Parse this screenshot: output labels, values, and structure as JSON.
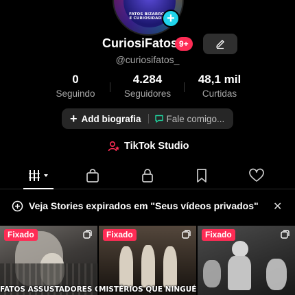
{
  "profile": {
    "avatar_text_line1": "FATOS BIZARROS",
    "avatar_text_line2": "E CURIOSIDADES",
    "display_name": "CuriosiFatos",
    "notification_badge": "9+",
    "handle": "@curiosifatos_"
  },
  "stats": [
    {
      "value": "0",
      "label": "Seguindo"
    },
    {
      "value": "4.284",
      "label": "Seguidores"
    },
    {
      "value": "48,1 mil",
      "label": "Curtidas"
    }
  ],
  "actions": {
    "add_bio_label": "Add biografia",
    "contact_label": "Fale comigo..."
  },
  "studio": {
    "label": "TikTok Studio"
  },
  "tabs": [
    {
      "icon": "grid-icon",
      "active": true
    },
    {
      "icon": "shop-bag-icon",
      "active": false
    },
    {
      "icon": "lock-icon",
      "active": false
    },
    {
      "icon": "bookmark-icon",
      "active": false
    },
    {
      "icon": "heart-icon",
      "active": false
    }
  ],
  "banner": {
    "text": "Veja Stories expirados em \"Seus vídeos privados\"",
    "close": "✕"
  },
  "videos": [
    {
      "pinned_label": "Fixado",
      "caption": "FATOS ASSUSTADORES QUE"
    },
    {
      "pinned_label": "Fixado",
      "caption": "MISTÉRIOS QUE NINGUÉM"
    },
    {
      "pinned_label": "Fixado",
      "caption": ""
    }
  ],
  "colors": {
    "accent": "#fe2c55",
    "plus_button": "#20d5ec",
    "background": "#000000",
    "pill": "#262626"
  }
}
